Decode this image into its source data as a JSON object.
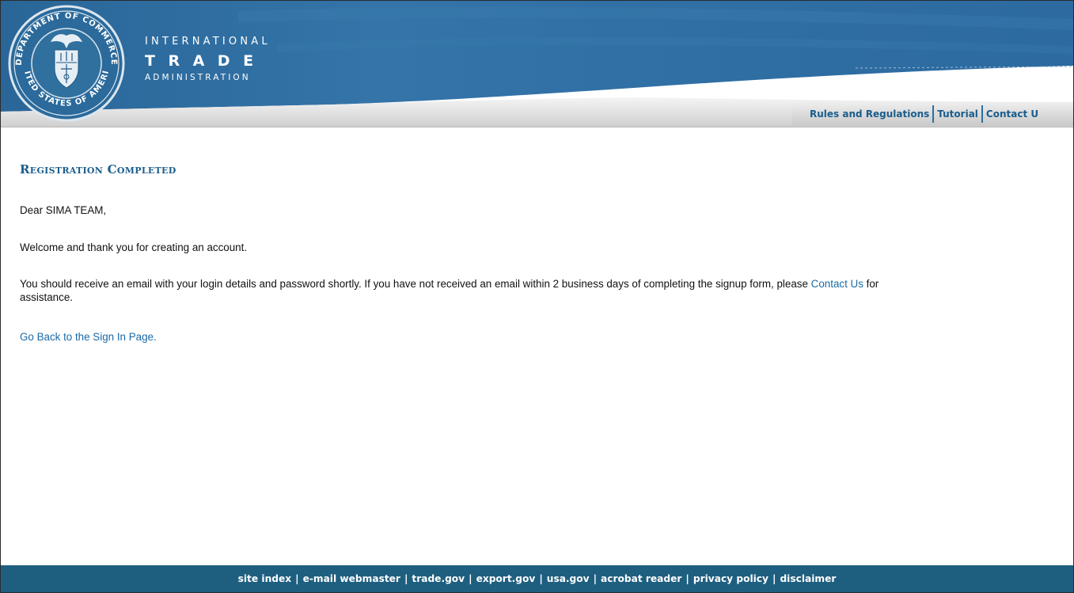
{
  "header": {
    "brand_line1": "INTERNATIONAL",
    "brand_line2": "TRADE",
    "brand_line3": "ADMINISTRATION",
    "seal_text_top": "DEPARTMENT OF COMMERCE",
    "seal_text_bottom": "UNITED STATES OF AMERICA",
    "seal_icon": "department-of-commerce-seal",
    "nav": [
      {
        "label": "Rules and Regulations"
      },
      {
        "label": "Tutorial"
      },
      {
        "label": "Contact U"
      }
    ]
  },
  "main": {
    "title": "Registration Completed",
    "greeting": "Dear SIMA TEAM,",
    "welcome": "Welcome and thank you for creating an account.",
    "info_part1": "You should receive an email with your login details and password shortly. If you have not received an email within 2 business days of completing the signup form, please ",
    "info_link": "Contact Us",
    "info_part2": " for assistance.",
    "back_link": "Go Back to the Sign In Page."
  },
  "footer": {
    "links": [
      {
        "label": "site index"
      },
      {
        "label": "e-mail webmaster"
      },
      {
        "label": "trade.gov"
      },
      {
        "label": "export.gov"
      },
      {
        "label": "usa.gov"
      },
      {
        "label": "acrobat reader"
      },
      {
        "label": "privacy policy"
      },
      {
        "label": "disclaimer"
      }
    ],
    "separator": "|"
  },
  "colors": {
    "header_blue": "#2e6a9c",
    "link_blue": "#1a6aa6",
    "title_blue": "#1a5d8c",
    "footer_bg": "#1e5f80"
  }
}
